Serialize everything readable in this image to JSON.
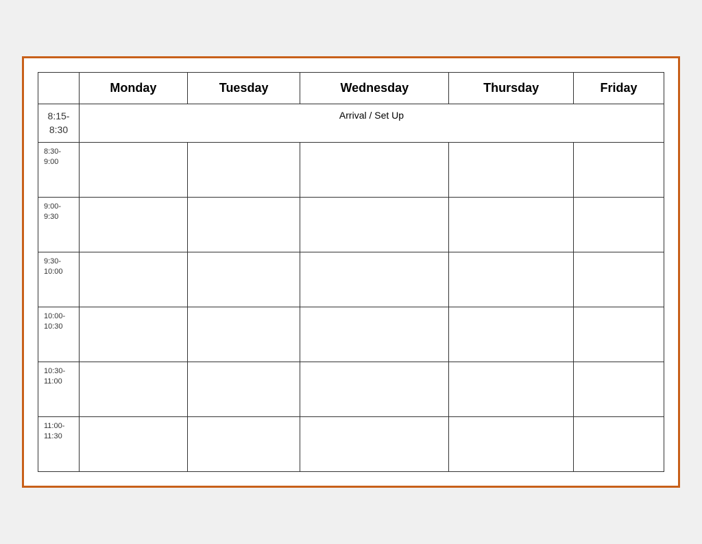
{
  "table": {
    "headers": {
      "time": "",
      "monday": "Monday",
      "tuesday": "Tuesday",
      "wednesday": "Wednesday",
      "thursday": "Thursday",
      "friday": "Friday"
    },
    "arrival_row": {
      "time": "8:15-\n8:30",
      "label": "Arrival / Set Up"
    },
    "rows": [
      {
        "time": "8:30-\n9:00"
      },
      {
        "time": "9:00-\n9:30"
      },
      {
        "time": "9:30-\n10:00"
      },
      {
        "time": "10:00-\n10:30"
      },
      {
        "time": "10:30-\n11:00"
      },
      {
        "time": "11:00-\n11:30"
      }
    ]
  },
  "border_color": "#c8601a"
}
